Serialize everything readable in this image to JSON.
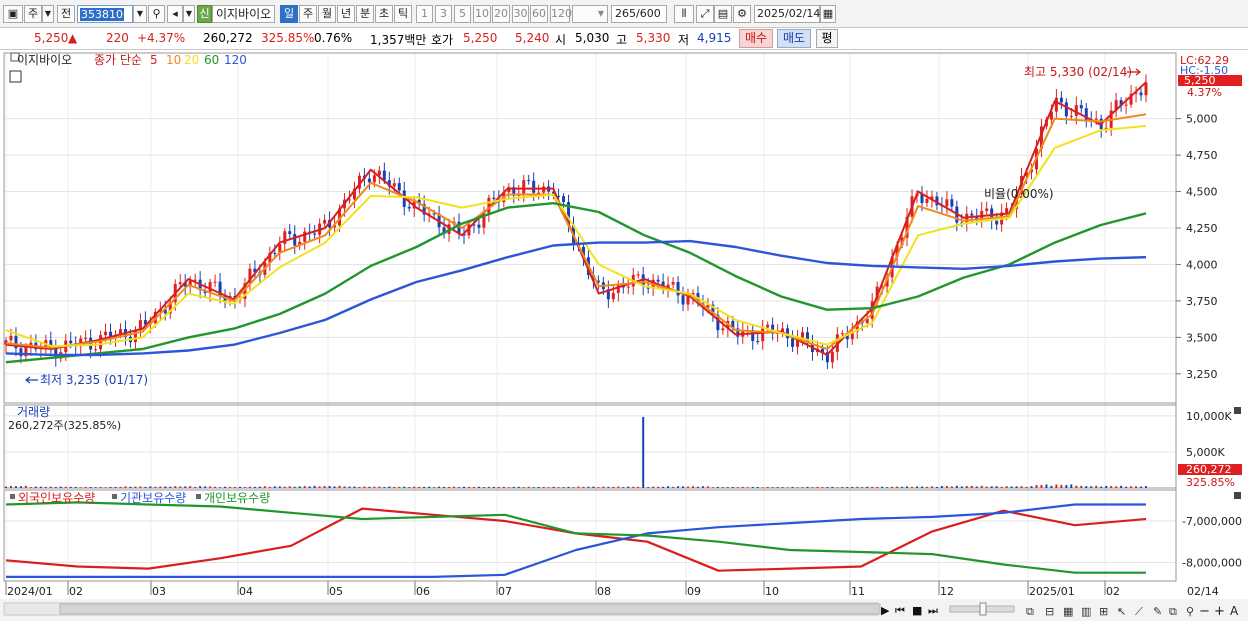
{
  "toolbar": {
    "type_label": "주",
    "prev_label": "전",
    "code": "353810",
    "new_badge": "신",
    "stock_name": "이지바이오",
    "periods": [
      {
        "label": "일",
        "selected": true
      },
      {
        "label": "주",
        "selected": false
      },
      {
        "label": "월",
        "selected": false
      },
      {
        "label": "년",
        "selected": false
      },
      {
        "label": "분",
        "selected": false
      },
      {
        "label": "초",
        "selected": false
      },
      {
        "label": "틱",
        "selected": false
      }
    ],
    "minutes": [
      "1",
      "3",
      "5",
      "10",
      "20",
      "30",
      "60",
      "120"
    ],
    "count": "265",
    "count_total": "/600",
    "date": "2025/02/14"
  },
  "quote": {
    "price": "5,250",
    "arrow": "▲",
    "change": "220",
    "change_pct": "+4.37%",
    "volume": "260,272",
    "volume_ratio": "325.85%",
    "turnover": "0.76%",
    "amount": "1,357백만",
    "ask_label": "호가",
    "ask1": "5,250",
    "ask2": "5,240",
    "open_label": "시",
    "open": "5,030",
    "high_label": "고",
    "high": "5,330",
    "low_label": "저",
    "low": "4,915",
    "buy_label": "매수",
    "sell_label": "매도",
    "eval_label": "평"
  },
  "legend": {
    "name": "이지바이오",
    "series_label": "종가 단순",
    "ma": [
      {
        "label": "5",
        "color": "#d81f1f"
      },
      {
        "label": "10",
        "color": "#f08a1c"
      },
      {
        "label": "20",
        "color": "#f2e21c"
      },
      {
        "label": "60",
        "color": "#22962c"
      },
      {
        "label": "120",
        "color": "#2c56d8"
      }
    ]
  },
  "annotations": {
    "high": "최고 5,330 (02/14)",
    "low": "최저 3,235 (01/17)",
    "mid": "비율(0.00%)",
    "lc": "LC:62.29",
    "hc": "HC:-1.50",
    "last_price": "5,250",
    "last_pct": "4.37%"
  },
  "volume_panel": {
    "title": "거래량",
    "value": "260,272주(325.85%)",
    "last_label": "260,272",
    "last_pct": "325.85%"
  },
  "holders_panel": {
    "labels": [
      "외국인보유수량",
      "기관보유수량",
      "개인보유수량"
    ],
    "colors": [
      "#d81f1f",
      "#2c56d8",
      "#22962c"
    ]
  },
  "x_axis_labels": [
    "2024/01",
    "02",
    "03",
    "04",
    "05",
    "06",
    "07",
    "08",
    "09",
    "10",
    "11",
    "12",
    "2025/01",
    "02",
    "02/14"
  ],
  "chart_data": [
    {
      "type": "line",
      "title": "이지바이오",
      "x": [
        "2024/01",
        "02",
        "03",
        "04",
        "05",
        "06",
        "07",
        "08",
        "09",
        "10",
        "11",
        "12",
        "2025/01",
        "02",
        "02/14"
      ],
      "yticks": [
        3250,
        3500,
        3750,
        4000,
        4250,
        4500,
        4750,
        5000
      ],
      "ytick_labels": [
        "3,250",
        "3,500",
        "3,750",
        "4,000",
        "4,250",
        "4,500",
        "4,750",
        "5,000"
      ],
      "ylim": [
        3050,
        5450
      ],
      "series": [
        {
          "name": "5",
          "color": "#d81f1f",
          "values": [
            3450,
            3420,
            3480,
            3560,
            3900,
            3760,
            4150,
            4250,
            4650,
            4390,
            4200,
            4520,
            4520,
            3800,
            3900,
            3780,
            3520,
            3540,
            3380,
            3700,
            4500,
            4320,
            4350,
            5120,
            4960,
            5250
          ]
        },
        {
          "name": "10",
          "color": "#f08a1c",
          "values": [
            3460,
            3430,
            3470,
            3540,
            3860,
            3750,
            4080,
            4200,
            4560,
            4430,
            4250,
            4480,
            4480,
            3850,
            3880,
            3790,
            3550,
            3530,
            3420,
            3660,
            4400,
            4300,
            4330,
            5000,
            4980,
            5030
          ]
        },
        {
          "name": "20",
          "color": "#f2e21c",
          "values": [
            3550,
            3440,
            3450,
            3500,
            3800,
            3730,
            3980,
            4150,
            4470,
            4460,
            4390,
            4450,
            4480,
            4000,
            3850,
            3800,
            3620,
            3530,
            3450,
            3600,
            4200,
            4280,
            4320,
            4800,
            4920,
            4950
          ]
        },
        {
          "name": "60",
          "color": "#22962c",
          "values": [
            3330,
            3360,
            3390,
            3420,
            3500,
            3560,
            3660,
            3800,
            3990,
            4120,
            4280,
            4390,
            4420,
            4360,
            4200,
            4080,
            3920,
            3780,
            3690,
            3700,
            3780,
            3910,
            4000,
            4150,
            4270,
            4350
          ]
        },
        {
          "name": "120",
          "color": "#2c56d8",
          "values": [
            3390,
            3380,
            3380,
            3390,
            3410,
            3450,
            3530,
            3620,
            3760,
            3880,
            3960,
            4050,
            4130,
            4150,
            4150,
            4160,
            4120,
            4060,
            4010,
            3990,
            3980,
            3970,
            3990,
            4020,
            4040,
            4050
          ]
        }
      ]
    },
    {
      "type": "bar",
      "title": "거래량",
      "yticks": [
        5000,
        10000
      ],
      "ytick_labels": [
        "5,000K",
        "10,000K"
      ],
      "ylim": [
        0,
        11500
      ],
      "values": [
        300,
        200,
        150,
        220,
        260,
        180,
        240,
        300,
        210,
        190,
        180,
        170,
        160,
        200,
        10000,
        250,
        150,
        140,
        160,
        180,
        220,
        300,
        260,
        500,
        300,
        260
      ]
    },
    {
      "type": "line",
      "title": "외국인보유수량 · 기관보유수량 · 개인보유수량",
      "yticks": [
        -7000000,
        -8000000
      ],
      "ytick_labels": [
        "-7,000,000",
        "-8,000,000"
      ],
      "ylim": [
        -8450000,
        -6250000
      ],
      "series": [
        {
          "name": "외국인보유수량",
          "color": "#d81f1f",
          "values": [
            -7950000,
            -8100000,
            -8150000,
            -7900000,
            -7600000,
            -6700000,
            -6850000,
            -7000000,
            -7300000,
            -7500000,
            -8200000,
            -8150000,
            -8100000,
            -7250000,
            -6750000,
            -7100000,
            -6950000
          ]
        },
        {
          "name": "기관보유수량",
          "color": "#2c56d8",
          "values": [
            -8350000,
            -8350000,
            -8350000,
            -8350000,
            -8350000,
            -8350000,
            -8350000,
            -8300000,
            -7700000,
            -7300000,
            -7150000,
            -7050000,
            -6950000,
            -6900000,
            -6800000,
            -6600000,
            -6600000
          ]
        },
        {
          "name": "개인보유수량",
          "color": "#22962c",
          "values": [
            -6600000,
            -6550000,
            -6600000,
            -6650000,
            -6800000,
            -6950000,
            -6900000,
            -6850000,
            -7300000,
            -7350000,
            -7500000,
            -7700000,
            -7750000,
            -7800000,
            -8050000,
            -8250000,
            -8250000
          ]
        }
      ]
    }
  ]
}
